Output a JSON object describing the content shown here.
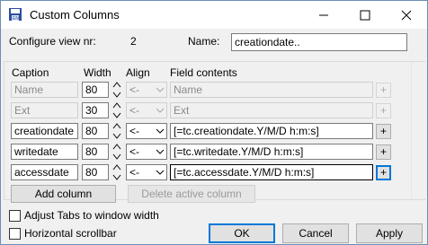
{
  "window": {
    "title": "Custom Columns"
  },
  "header": {
    "view_label": "Configure view nr:",
    "view_number": "2",
    "name_label": "Name:",
    "name_value": "creationdate.."
  },
  "columns_header": {
    "caption": "Caption",
    "width": "Width",
    "align": "Align",
    "field": "Field contents"
  },
  "rows": [
    {
      "caption": "Name",
      "width": "80",
      "align": "<-",
      "field": "Name",
      "plus": "+",
      "enabled": false
    },
    {
      "caption": "Ext",
      "width": "30",
      "align": "<-",
      "field": "Ext",
      "plus": "+",
      "enabled": false
    },
    {
      "caption": "creationdate",
      "width": "80",
      "align": "<-",
      "field": "[=tc.creationdate.Y/M/D h:m:s]",
      "plus": "+",
      "enabled": true
    },
    {
      "caption": "writedate",
      "width": "80",
      "align": "<-",
      "field": "[=tc.writedate.Y/M/D h:m:s]",
      "plus": "+",
      "enabled": true
    },
    {
      "caption": "accessdate",
      "width": "80",
      "align": "<-",
      "field": "[=tc.accessdate.Y/M/D h:m:s]",
      "plus": "+",
      "enabled": true
    }
  ],
  "buttons": {
    "add_column": "Add column",
    "delete_column": "Delete active column",
    "ok": "OK",
    "cancel": "Cancel",
    "apply": "Apply"
  },
  "options": {
    "adjust_tabs": "Adjust Tabs to window width",
    "horizontal_scrollbar": "Horizontal scrollbar"
  },
  "icons": {
    "app": "app-disk-icon",
    "minimize": "minimize-icon",
    "maximize": "maximize-icon",
    "close": "close-icon",
    "dropdown": "chevron-down-icon",
    "spin": "spin-arrows-icon"
  },
  "colors": {
    "focus": "#0078d7",
    "disabled_text": "#8a8a8a"
  }
}
